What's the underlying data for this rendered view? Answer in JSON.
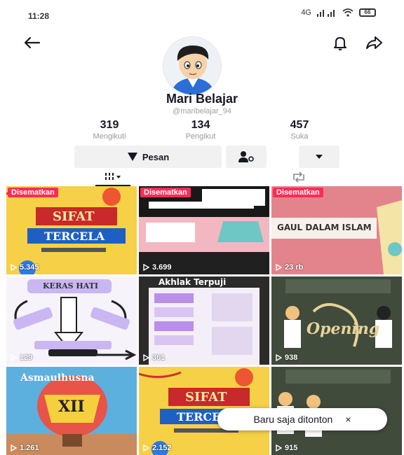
{
  "status_bar": {
    "time": "11:28",
    "network": "4G",
    "battery": "66"
  },
  "profile": {
    "display_name": "Mari Belajar",
    "username": "@maribelajar_94"
  },
  "stats": [
    {
      "value": "319",
      "label": "Mengikuti"
    },
    {
      "value": "134",
      "label": "Pengikut"
    },
    {
      "value": "457",
      "label": "Suka"
    }
  ],
  "actions": {
    "message_label": "Pesan"
  },
  "videos": [
    {
      "pinned": true,
      "badge": "Disematkan",
      "views": "5.345",
      "title1": "SIFAT",
      "title2": "TERCELA"
    },
    {
      "pinned": true,
      "badge": "Disematkan",
      "views": "3.699",
      "title1": ""
    },
    {
      "pinned": true,
      "badge": "Disematkan",
      "views": "23 rb",
      "title1": "GAUL DALAM ISLAM"
    },
    {
      "pinned": false,
      "badge": "",
      "views": "129",
      "title1": "KERAS HATI"
    },
    {
      "pinned": false,
      "badge": "",
      "views": "361",
      "title1": "Akhlak Terpuji"
    },
    {
      "pinned": false,
      "badge": "",
      "views": "938",
      "title1": "Opening"
    },
    {
      "pinned": false,
      "badge": "",
      "views": "1.261",
      "title1": "Asmaulhusna",
      "title2": "XII"
    },
    {
      "pinned": false,
      "badge": "",
      "views": "2.152",
      "title1": "SIFAT",
      "title2": "TERCELA"
    },
    {
      "pinned": false,
      "badge": "",
      "views": "915",
      "title1": ""
    }
  ],
  "toast": {
    "text": "Baru saja ditonton",
    "close": "×"
  },
  "colors": {
    "badge": "#fe2c55",
    "button_bg": "#f1f1f2",
    "text": "#161823"
  }
}
